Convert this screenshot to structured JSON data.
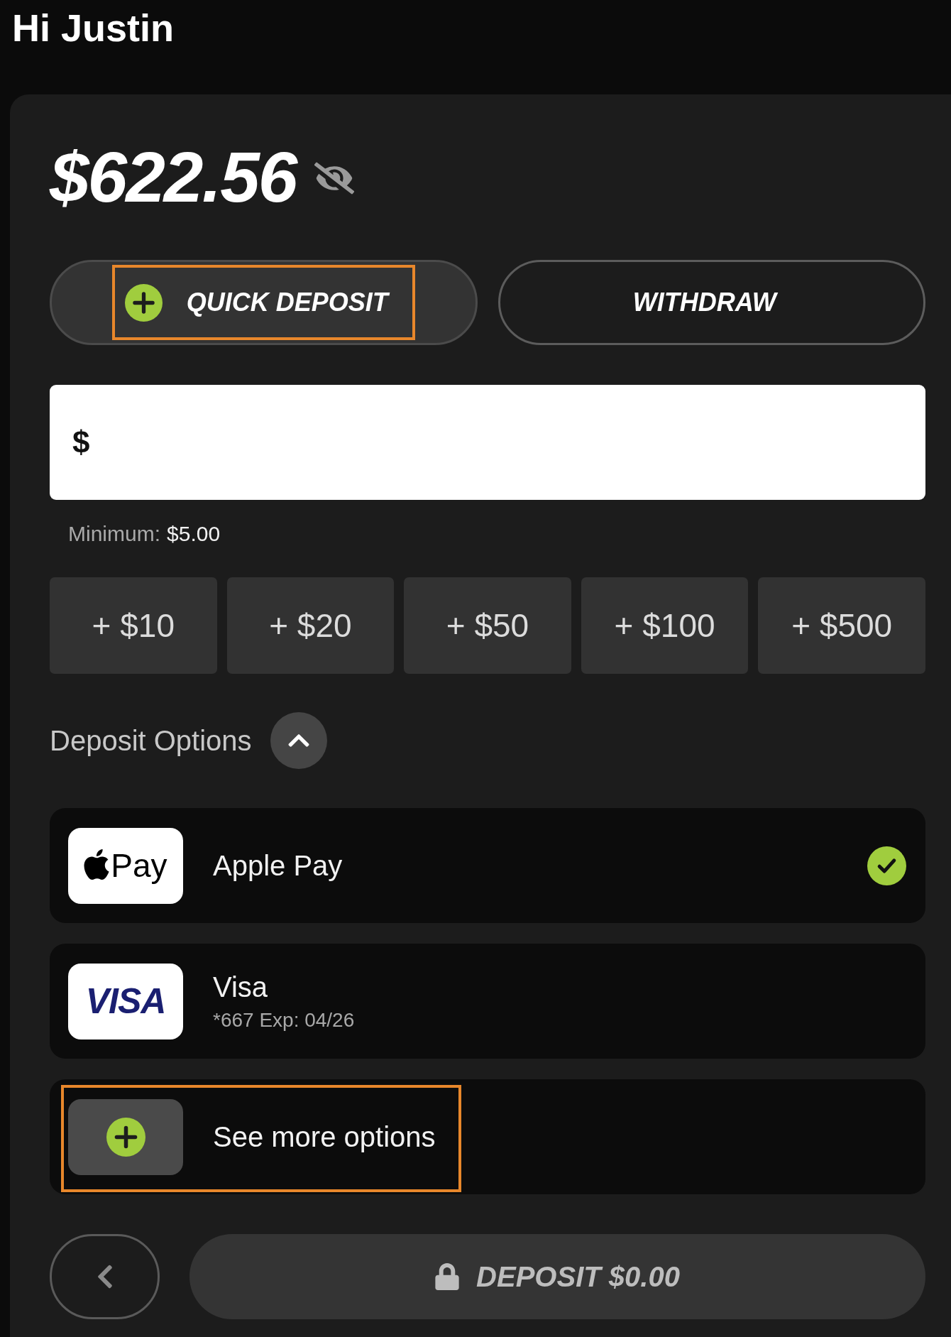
{
  "greeting": "Hi Justin",
  "balance": {
    "amount": "$622.56"
  },
  "actions": [
    {
      "kind": "deposit",
      "label": "QUICK DEPOSIT",
      "selected": true,
      "highlighted": true
    },
    {
      "kind": "withdraw",
      "label": "WITHDRAW",
      "selected": false,
      "highlighted": false
    }
  ],
  "amount_field": {
    "prefix": "$"
  },
  "minimum": {
    "label": "Minimum:",
    "value": "$5.00"
  },
  "quick_amounts": [
    "+ $10",
    "+ $20",
    "+ $50",
    "+ $100",
    "+ $500"
  ],
  "deposit_options": {
    "title": "Deposit Options",
    "expanded": true,
    "items": [
      {
        "kind": "wallet",
        "logo": "Pay",
        "name": "Apple Pay",
        "selected": true,
        "highlighted": false
      },
      {
        "kind": "card",
        "logo": "VISA",
        "name": "Visa",
        "detail": "*667 Exp: 04/26",
        "selected": false,
        "highlighted": false
      },
      {
        "kind": "more",
        "name": "See more options",
        "selected": false,
        "highlighted": true
      }
    ]
  },
  "deposit_button": {
    "label": "DEPOSIT $0.00",
    "disabled": true
  }
}
